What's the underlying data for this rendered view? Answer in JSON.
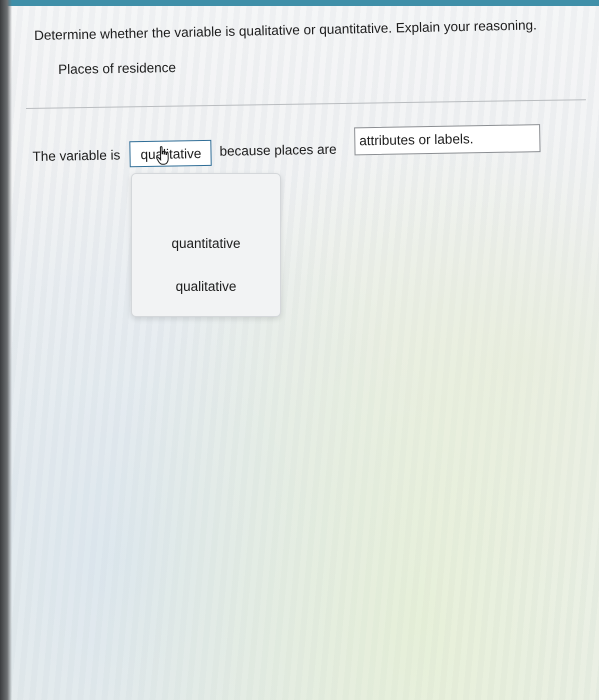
{
  "question": {
    "prompt": "Determine whether the variable is qualitative or quantitative. Explain your reasoning.",
    "subject": "Places of residence"
  },
  "answer": {
    "prefix": "The variable is",
    "selected_value": "qualitative",
    "middle_text": "because places are",
    "reason_value": "attributes or labels."
  },
  "menu": {
    "options": [
      "quantitative",
      "qualitative"
    ]
  },
  "colors": {
    "top_bar": "#3f8fa8",
    "dropdown_border": "#2f6d96"
  }
}
